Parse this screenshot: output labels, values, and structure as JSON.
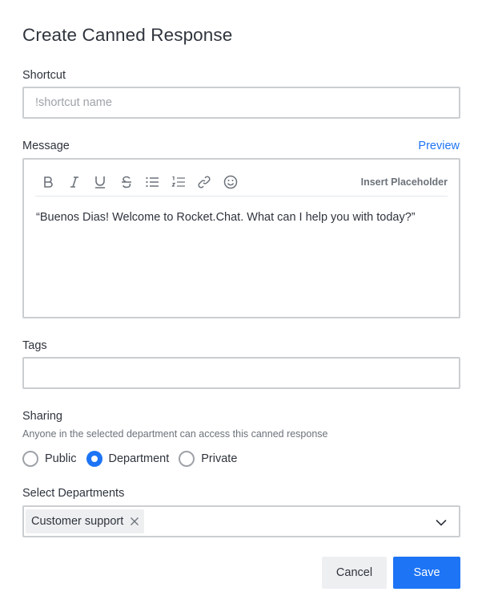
{
  "dialog": {
    "title": "Create Canned Response"
  },
  "shortcut": {
    "label": "Shortcut",
    "value": "",
    "placeholder": "!shortcut name"
  },
  "message": {
    "label": "Message",
    "preview_label": "Preview",
    "toolbar": {
      "tools": [
        "bold-icon",
        "italic-icon",
        "underline-icon",
        "strikethrough-icon",
        "bullet-list-icon",
        "numbered-list-icon",
        "link-icon",
        "emoji-icon"
      ],
      "insert_placeholder_label": "Insert Placeholder"
    },
    "text": "“Buenos Dias! Welcome to Rocket.Chat. What can I help you with today?”"
  },
  "tags": {
    "label": "Tags",
    "value": ""
  },
  "sharing": {
    "label": "Sharing",
    "hint": "Anyone in the selected department can access this canned response",
    "options": [
      "Public",
      "Department",
      "Private"
    ],
    "selected": "Department"
  },
  "departments": {
    "label": "Select Departments",
    "selected": [
      "Customer support"
    ]
  },
  "actions": {
    "cancel_label": "Cancel",
    "save_label": "Save"
  },
  "colors": {
    "accent": "#1d74f5",
    "border": "#cbced1",
    "text": "#2f343d",
    "muted": "#6c727a"
  }
}
